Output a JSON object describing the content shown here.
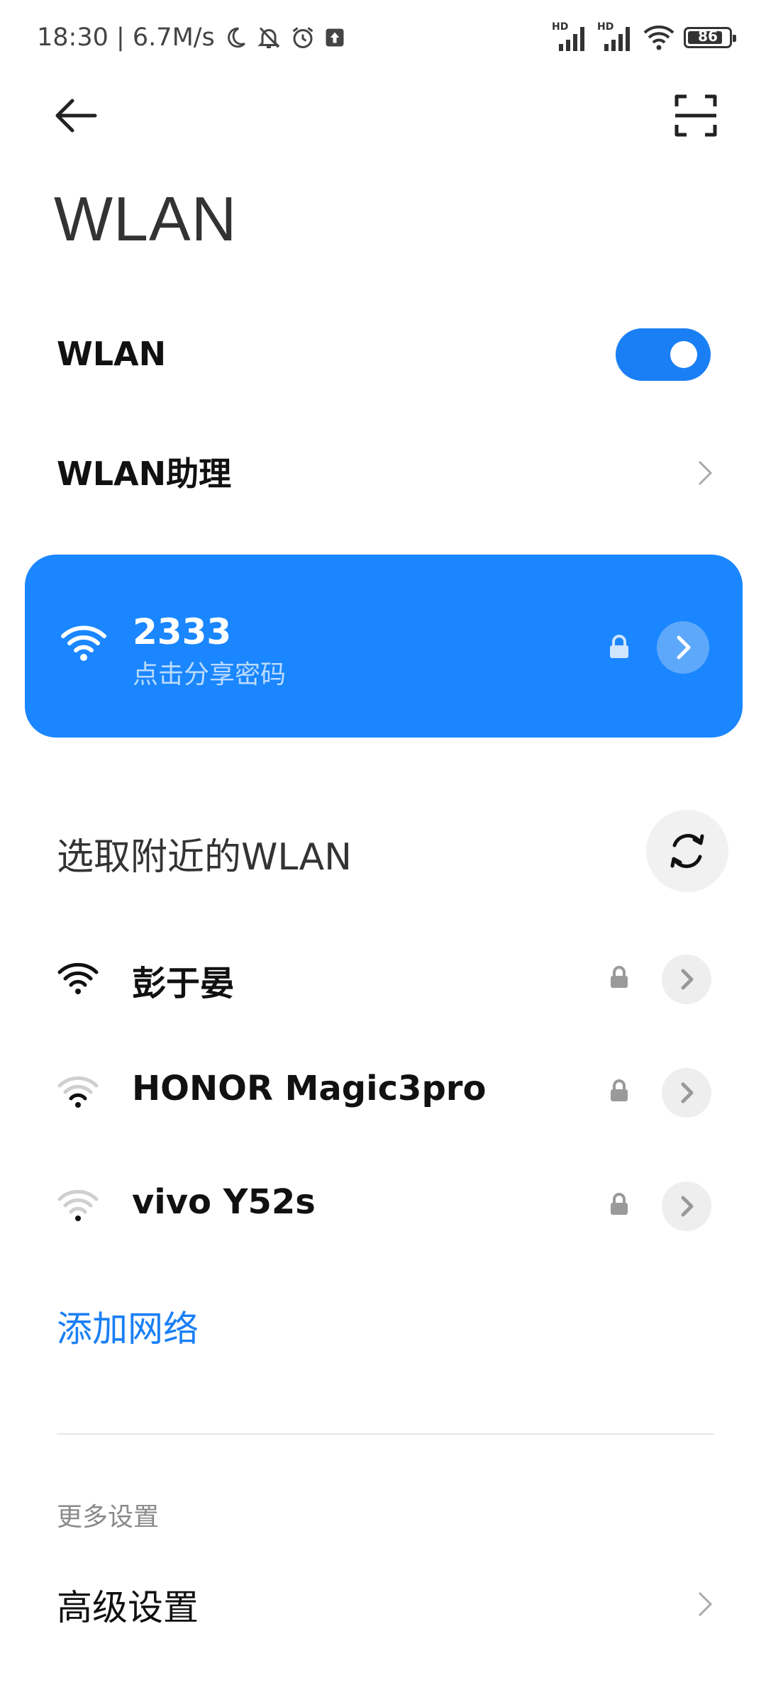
{
  "status_bar": {
    "time_speed": "18:30 | 6.7M/s",
    "sim1_badge": "HD",
    "sim2_badge": "HD",
    "battery": "86",
    "icons": [
      "moon-icon",
      "bell-off-icon",
      "alarm-icon",
      "upload-icon",
      "signal-icon",
      "signal-icon",
      "wifi-icon",
      "battery-icon"
    ]
  },
  "header": {
    "title": "WLAN",
    "back_icon": "arrow-left-icon",
    "scan_icon": "scan-icon"
  },
  "settings": {
    "wlan_label": "WLAN",
    "wlan_enabled": true,
    "assistant_label": "WLAN助理"
  },
  "connected": {
    "name": "2333",
    "subtitle": "点击分享密码",
    "color": "#1a86ff"
  },
  "nearby": {
    "title": "选取附近的WLAN",
    "networks": [
      {
        "name": "彭于晏",
        "signal": 3
      },
      {
        "name": "HONOR Magic3pro",
        "signal": 1
      },
      {
        "name": "vivo Y52s",
        "signal": 0
      }
    ]
  },
  "add_network": "添加网络",
  "more": {
    "section_label": "更多设置",
    "advanced_label": "高级设置"
  },
  "colors": {
    "accent": "#1a7ff5",
    "card": "#1a86ff"
  }
}
